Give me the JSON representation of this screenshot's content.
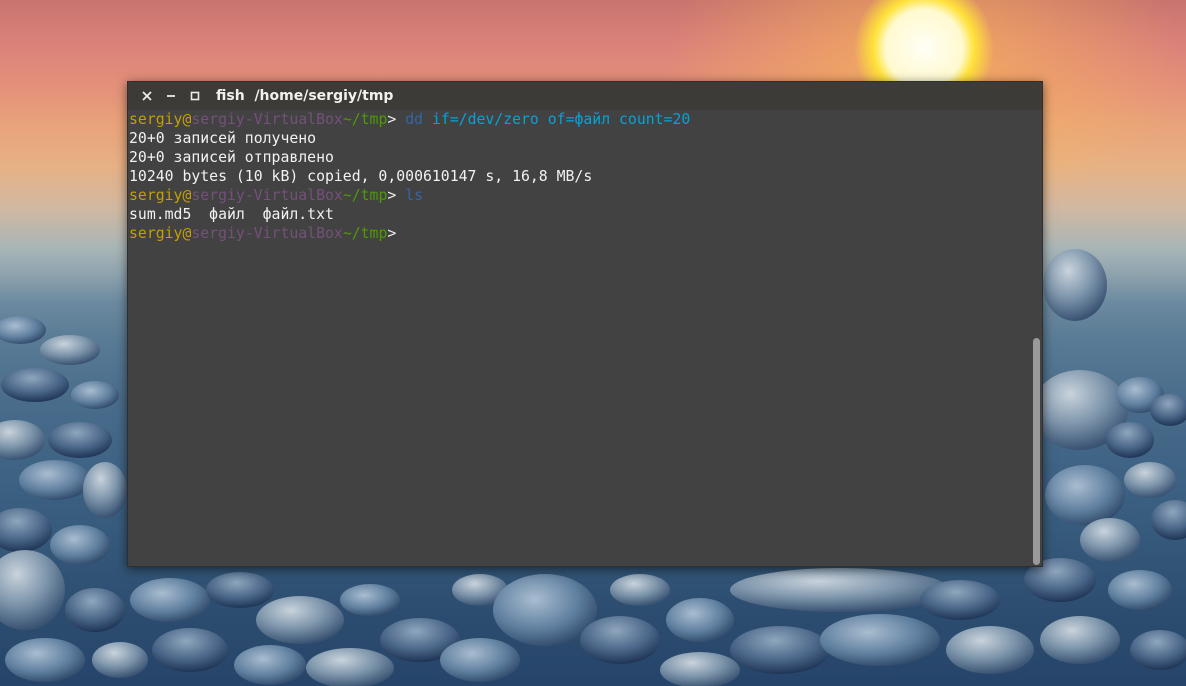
{
  "window": {
    "title_app": "fish",
    "title_path": "/home/sergiy/tmp",
    "buttons": [
      {
        "name": "close-icon"
      },
      {
        "name": "minimize-icon"
      },
      {
        "name": "maximize-icon"
      }
    ]
  },
  "prompt": {
    "user": "sergiy",
    "at": "@",
    "host": "sergiy-VirtualBox",
    "path": "~/tmp",
    "symbol": "> "
  },
  "lines": [
    {
      "type": "prompt",
      "cmd": "dd",
      "args": " if=/dev/zero of=файл count=20"
    },
    {
      "type": "output",
      "text": "20+0 записей получено"
    },
    {
      "type": "output",
      "text": "20+0 записей отправлено"
    },
    {
      "type": "output",
      "text": "10240 bytes (10 kB) copied, 0,000610147 s, 16,8 MB/s"
    },
    {
      "type": "prompt",
      "cmd": "ls",
      "args": ""
    },
    {
      "type": "output",
      "text": "sum.md5  файл  файл.txt"
    },
    {
      "type": "prompt",
      "cmd": "",
      "args": ""
    }
  ],
  "colors": {
    "user": "#c4a000",
    "host": "#75507b",
    "path": "#4e9a06",
    "command": "#3465a4",
    "argument": "#06a3d7",
    "background": "#424242",
    "titlebar": "#3c3b37"
  }
}
